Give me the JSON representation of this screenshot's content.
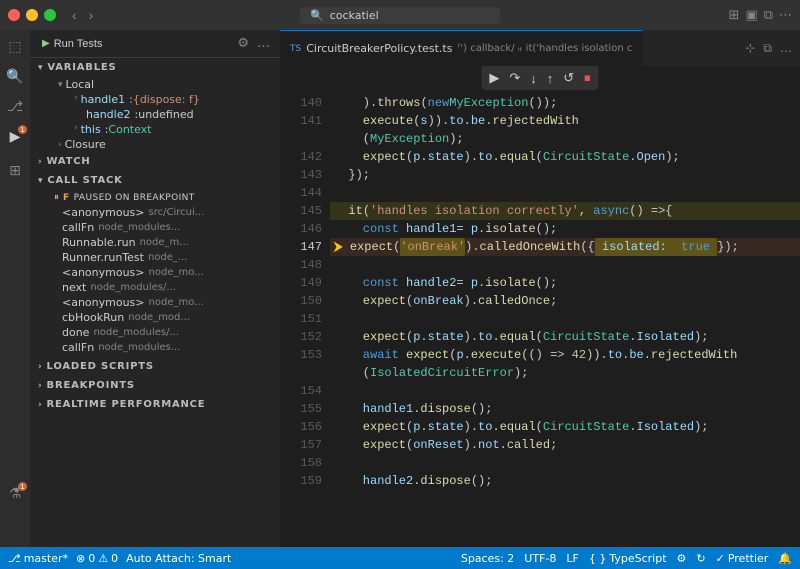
{
  "titlebar": {
    "search_placeholder": "cockatiel",
    "nav_back": "‹",
    "nav_forward": "›"
  },
  "debug_toolbar": {
    "run_label": "Run Tests",
    "settings_icon": "⚙",
    "more_icon": "…"
  },
  "sidebar": {
    "variables_label": "VARIABLES",
    "local_label": "Local",
    "vars": [
      {
        "name": "handle1",
        "value": "{dispose: f}"
      },
      {
        "name": "handle2",
        "value": "undefined"
      },
      {
        "name": "this",
        "value": "Context"
      }
    ],
    "closure_label": "Closure",
    "watch_label": "Watch",
    "call_stack_label": "CALL STACK",
    "paused_label": "PAUSED ON BREAKPOINT",
    "call_stack_items": [
      {
        "fn": "<anonymous>",
        "file": "src/Circui..."
      },
      {
        "fn": "callFn",
        "file": "node_modules..."
      },
      {
        "fn": "Runnable.run",
        "file": "node_m..."
      },
      {
        "fn": "Runner.runTest",
        "file": "node_..."
      },
      {
        "fn": "<anonymous>",
        "file": "node_mo..."
      },
      {
        "fn": "next",
        "file": "node_modules/..."
      },
      {
        "fn": "<anonymous>",
        "file": "node_mo..."
      },
      {
        "fn": "cbHookRun",
        "file": "node_mod..."
      },
      {
        "fn": "done",
        "file": "node_modules/..."
      },
      {
        "fn": "callFn",
        "file": "node_modules..."
      }
    ],
    "loaded_scripts_label": "LOADED SCRIPTS",
    "breakpoints_label": "BREAKPOINTS",
    "realtime_label": "REALTIME PERFORMANCE"
  },
  "editor": {
    "tab_lang": "TS",
    "tab_name": "CircuitBreakerPolicy.test.ts",
    "tab_path": "ᶠ') callback/ ᵢₜ it('handles isolation c",
    "breadcrumb": "CircuitBreakerPolicy.test.ts > ᶠ callback > ᵢₜ it('handles isolation c"
  },
  "code_lines": [
    {
      "num": 140,
      "content": "    ).throws(new MyException());"
    },
    {
      "num": 141,
      "content": "    execute(s)).to.be.rejectedWith"
    },
    {
      "num": "",
      "content": "    (MyException);"
    },
    {
      "num": 142,
      "content": "    expect(p.state).to.equal(CircuitState.Open);"
    },
    {
      "num": 143,
      "content": "  });"
    },
    {
      "num": 144,
      "content": ""
    },
    {
      "num": 145,
      "content": "  it('handles isolation correctly', async () => {",
      "highlight": true
    },
    {
      "num": 146,
      "content": "    const handle1 = p.isolate();"
    },
    {
      "num": 147,
      "content": "    expect(onBreak).calledOnceWith({ isolated: true });",
      "breakpoint": true,
      "arrow": true
    },
    {
      "num": 148,
      "content": ""
    },
    {
      "num": 149,
      "content": "    const handle2 = p.isolate();"
    },
    {
      "num": 150,
      "content": "    expect(onBreak).calledOnce;"
    },
    {
      "num": 151,
      "content": ""
    },
    {
      "num": 152,
      "content": "    expect(p.state).to.equal(CircuitState.Isolated);"
    },
    {
      "num": 153,
      "content": "    await expect(p.execute(() => 42)).to.be.rejectedWith"
    },
    {
      "num": "",
      "content": "    (IsolatedCircuitError);"
    },
    {
      "num": 154,
      "content": ""
    },
    {
      "num": 155,
      "content": "    handle1.dispose();"
    },
    {
      "num": 156,
      "content": "    expect(p.state).to.equal(CircuitState.Isolated);"
    },
    {
      "num": 157,
      "content": "    expect(onReset).not.called;"
    },
    {
      "num": 158,
      "content": ""
    },
    {
      "num": 159,
      "content": "    handle2.dispose();"
    }
  ],
  "status_bar": {
    "branch": "master*",
    "errors": "0",
    "warnings": "0",
    "attach": "Auto Attach: Smart",
    "spaces": "Spaces: 2",
    "encoding": "UTF-8",
    "eol": "LF",
    "language": "TypeScript",
    "prettier": "Prettier"
  }
}
